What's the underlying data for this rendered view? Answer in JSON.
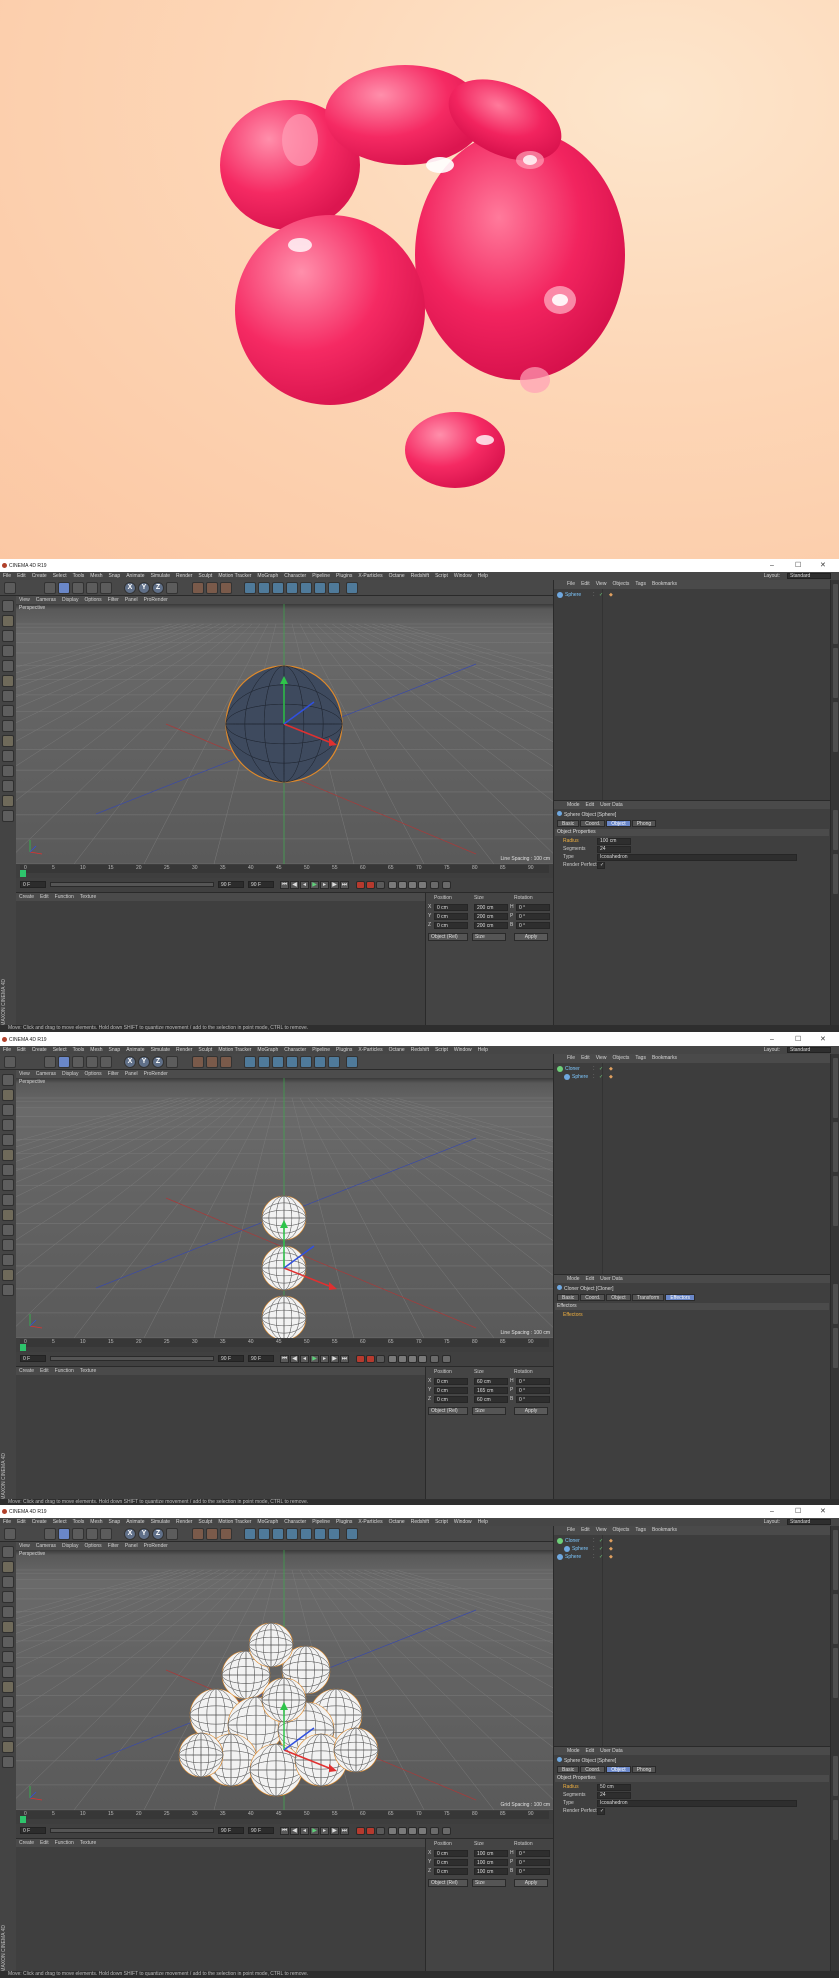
{
  "colors": {
    "accent_tab": "#6a87c8",
    "object_name": "#7ec8ff",
    "hero_bg": "#fdd6b6",
    "blob": "#f2245f"
  },
  "hero": {
    "description_icon": "pink-blob-render"
  },
  "windows": [
    {
      "title": "CINEMA 4D R19",
      "menu": [
        "File",
        "Edit",
        "Create",
        "Select",
        "Tools",
        "Mesh",
        "Snap",
        "Animate",
        "Simulate",
        "Render",
        "Sculpt",
        "Motion Tracker",
        "MoGraph",
        "Character",
        "Pipeline",
        "Plugins",
        "X-Particles",
        "Octane",
        "Redshift",
        "Script",
        "Window",
        "Help"
      ],
      "layout_label": "Layout:",
      "layout_value": "Standard",
      "view_menu": [
        "View",
        "Cameras",
        "Display",
        "Options",
        "Filter",
        "Panel",
        "ProRender"
      ],
      "camera": "Perspective",
      "grid_spacing": "Line Spacing : 100 cm",
      "timeline_ticks": [
        "0",
        "5",
        "10",
        "15",
        "20",
        "25",
        "30",
        "35",
        "40",
        "45",
        "50",
        "55",
        "60",
        "65",
        "70",
        "75",
        "80",
        "85",
        "90"
      ],
      "frame_current": "0 F",
      "frame_start": "0 F",
      "frame_end": "90 F",
      "frame_end2": "90 F",
      "material_menu": [
        "Create",
        "Edit",
        "Function",
        "Texture"
      ],
      "coord": {
        "position_label": "Position",
        "size_label": "Size",
        "rotation_label": "Rotation",
        "rows": [
          {
            "axis": "X",
            "pos": "0 cm",
            "size": "200 cm",
            "rot_axis": "H",
            "rot": "0 °"
          },
          {
            "axis": "Y",
            "pos": "0 cm",
            "size": "200 cm",
            "rot_axis": "P",
            "rot": "0 °"
          },
          {
            "axis": "Z",
            "pos": "0 cm",
            "size": "200 cm",
            "rot_axis": "B",
            "rot": "0 °"
          }
        ],
        "mode": "Object (Rel)",
        "size_mode": "Size",
        "apply": "Apply"
      },
      "om_menu": [
        "File",
        "Edit",
        "View",
        "Objects",
        "Tags",
        "Bookmarks"
      ],
      "objects": [
        {
          "name": "Sphere",
          "indent": 0,
          "icon_color": "#6fa8e0"
        }
      ],
      "am_menu": [
        "Mode",
        "Edit",
        "User Data"
      ],
      "am_title": "Sphere Object [Sphere]",
      "am_tabs": [
        "Basic",
        "Coord.",
        "Object",
        "Phong"
      ],
      "am_active_tab": "Object",
      "section": "Object Properties",
      "props": [
        {
          "label": "Radius",
          "value": "100 cm"
        },
        {
          "label": "Segments",
          "value": "24"
        },
        {
          "label": "Type",
          "value": "Icosahedron"
        },
        {
          "label": "Render Perfect",
          "value": "✓"
        }
      ],
      "status": "Move: Click and drag to move elements. Hold down SHIFT to quantize movement / add to the selection in point mode, CTRL to remove."
    },
    {
      "title": "CINEMA 4D R19",
      "menu": [
        "File",
        "Edit",
        "Create",
        "Select",
        "Tools",
        "Mesh",
        "Snap",
        "Animate",
        "Simulate",
        "Render",
        "Sculpt",
        "Motion Tracker",
        "MoGraph",
        "Character",
        "Pipeline",
        "Plugins",
        "X-Particles",
        "Octane",
        "Redshift",
        "Script",
        "Window",
        "Help"
      ],
      "layout_label": "Layout:",
      "layout_value": "Standard",
      "view_menu": [
        "View",
        "Cameras",
        "Display",
        "Options",
        "Filter",
        "Panel",
        "ProRender"
      ],
      "camera": "Perspective",
      "grid_spacing": "Line Spacing : 100 cm",
      "timeline_ticks": [
        "0",
        "5",
        "10",
        "15",
        "20",
        "25",
        "30",
        "35",
        "40",
        "45",
        "50",
        "55",
        "60",
        "65",
        "70",
        "75",
        "80",
        "85",
        "90"
      ],
      "frame_current": "0 F",
      "frame_start": "0 F",
      "frame_end": "90 F",
      "frame_end2": "90 F",
      "material_menu": [
        "Create",
        "Edit",
        "Function",
        "Texture"
      ],
      "coord": {
        "position_label": "Position",
        "size_label": "Size",
        "rotation_label": "Rotation",
        "rows": [
          {
            "axis": "X",
            "pos": "0 cm",
            "size": "60 cm",
            "rot_axis": "H",
            "rot": "0 °"
          },
          {
            "axis": "Y",
            "pos": "0 cm",
            "size": "165 cm",
            "rot_axis": "P",
            "rot": "0 °"
          },
          {
            "axis": "Z",
            "pos": "0 cm",
            "size": "60 cm",
            "rot_axis": "B",
            "rot": "0 °"
          }
        ],
        "mode": "Object (Rel)",
        "size_mode": "Size",
        "apply": "Apply"
      },
      "om_menu": [
        "File",
        "Edit",
        "View",
        "Objects",
        "Tags",
        "Bookmarks"
      ],
      "objects": [
        {
          "name": "Cloner",
          "indent": 0,
          "icon_color": "#6fd07a"
        },
        {
          "name": "Sphere",
          "indent": 1,
          "icon_color": "#6fa8e0"
        }
      ],
      "am_menu": [
        "Mode",
        "Edit",
        "User Data"
      ],
      "am_title": "Cloner Object [Cloner]",
      "am_tabs": [
        "Basic",
        "Coord.",
        "Object",
        "Transform",
        "Effectors"
      ],
      "am_active_tab": "Effectors",
      "section": "Effectors",
      "props": [
        {
          "label": "Effectors",
          "value": ""
        }
      ],
      "status": "Move: Click and drag to move elements. Hold down SHIFT to quantize movement / add to the selection in point mode, CTRL to remove."
    },
    {
      "title": "CINEMA 4D R19",
      "menu": [
        "File",
        "Edit",
        "Create",
        "Select",
        "Tools",
        "Mesh",
        "Snap",
        "Animate",
        "Simulate",
        "Render",
        "Sculpt",
        "Motion Tracker",
        "MoGraph",
        "Character",
        "Pipeline",
        "Plugins",
        "X-Particles",
        "Octane",
        "Redshift",
        "Script",
        "Window",
        "Help"
      ],
      "layout_label": "Layout:",
      "layout_value": "Standard",
      "view_menu": [
        "View",
        "Cameras",
        "Display",
        "Options",
        "Filter",
        "Panel",
        "ProRender"
      ],
      "camera": "Perspective",
      "grid_spacing": "Grid Spacing : 100 cm",
      "timeline_ticks": [
        "0",
        "5",
        "10",
        "15",
        "20",
        "25",
        "30",
        "35",
        "40",
        "45",
        "50",
        "55",
        "60",
        "65",
        "70",
        "75",
        "80",
        "85",
        "90"
      ],
      "frame_current": "0 F",
      "frame_start": "0 F",
      "frame_end": "90 F",
      "frame_end2": "90 F",
      "material_menu": [
        "Create",
        "Edit",
        "Function",
        "Texture"
      ],
      "coord": {
        "position_label": "Position",
        "size_label": "Size",
        "rotation_label": "Rotation",
        "rows": [
          {
            "axis": "X",
            "pos": "0 cm",
            "size": "100 cm",
            "rot_axis": "H",
            "rot": "0 °"
          },
          {
            "axis": "Y",
            "pos": "0 cm",
            "size": "100 cm",
            "rot_axis": "P",
            "rot": "0 °"
          },
          {
            "axis": "Z",
            "pos": "0 cm",
            "size": "100 cm",
            "rot_axis": "B",
            "rot": "0 °"
          }
        ],
        "mode": "Object (Rel)",
        "size_mode": "Size",
        "apply": "Apply"
      },
      "om_menu": [
        "File",
        "Edit",
        "View",
        "Objects",
        "Tags",
        "Bookmarks"
      ],
      "objects": [
        {
          "name": "Cloner",
          "indent": 0,
          "icon_color": "#6fd07a"
        },
        {
          "name": "Sphere",
          "indent": 1,
          "icon_color": "#6fa8e0"
        },
        {
          "name": "Sphere",
          "indent": 0,
          "icon_color": "#6fa8e0"
        }
      ],
      "am_menu": [
        "Mode",
        "Edit",
        "User Data"
      ],
      "am_title": "Sphere Object [Sphere]",
      "am_tabs": [
        "Basic",
        "Coord.",
        "Object",
        "Phong"
      ],
      "am_active_tab": "Object",
      "section": "Object Properties",
      "props": [
        {
          "label": "Radius",
          "value": "50 cm"
        },
        {
          "label": "Segments",
          "value": "24"
        },
        {
          "label": "Type",
          "value": "Icosahedron"
        },
        {
          "label": "Render Perfect",
          "value": "✓"
        }
      ],
      "status": "Move: Click and drag to move elements. Hold down SHIFT to quantize movement / add to the selection in point mode, CTRL to remove."
    }
  ]
}
